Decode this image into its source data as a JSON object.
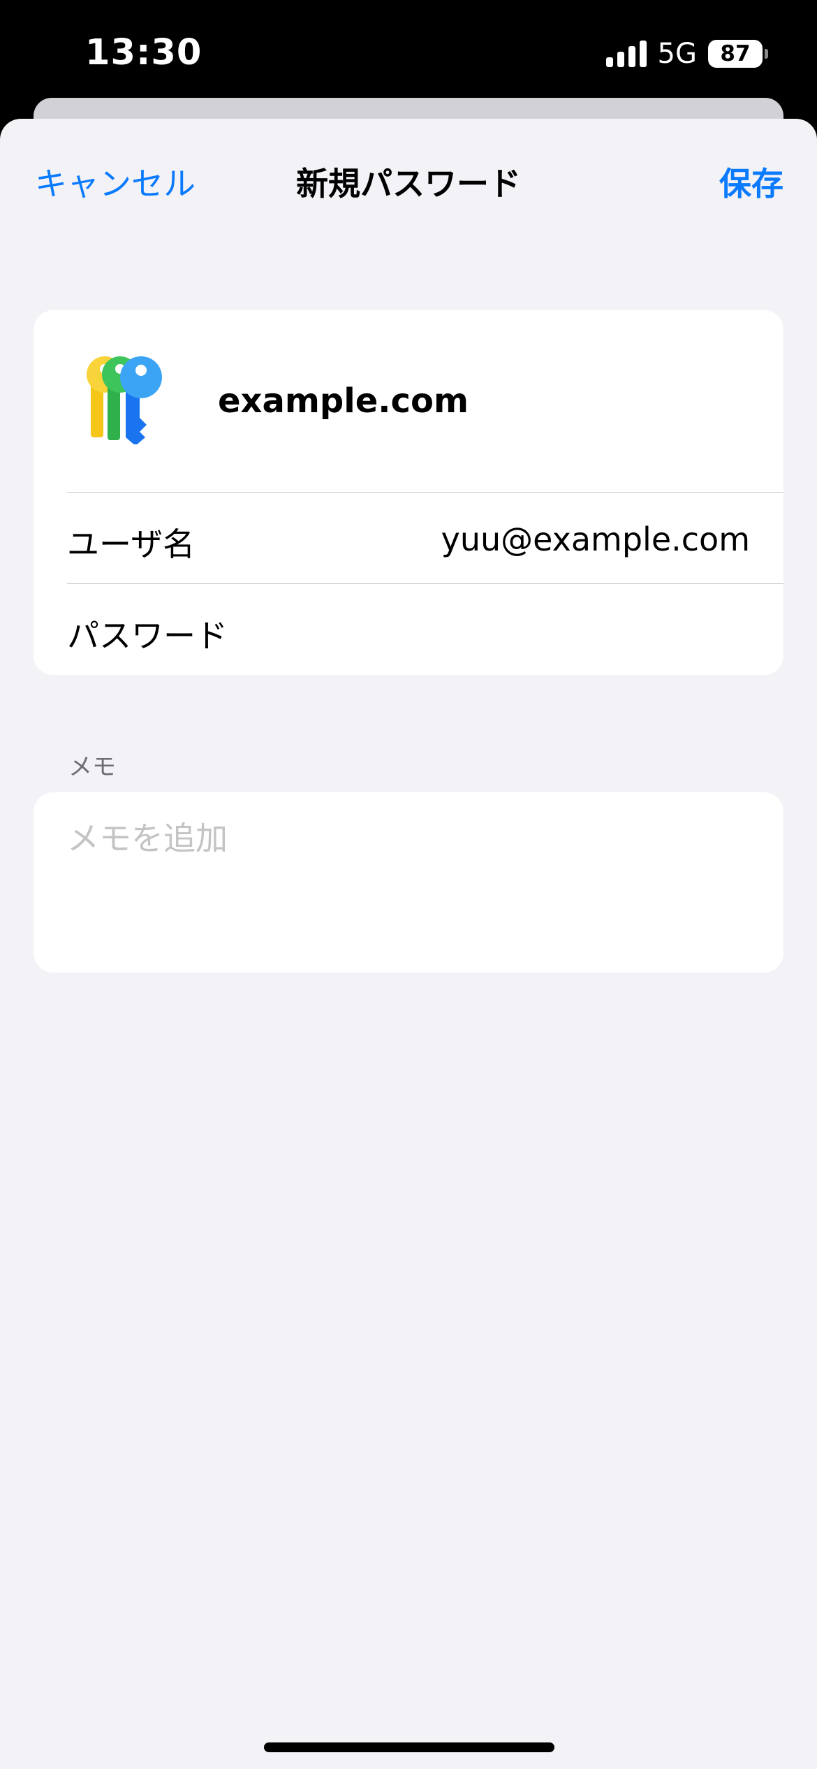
{
  "status_bar": {
    "time": "13:30",
    "network": "5G",
    "battery": "87"
  },
  "nav": {
    "cancel_label": "キャンセル",
    "title": "新規パスワード",
    "save_label": "保存"
  },
  "credential": {
    "site": "example.com",
    "username_label": "ユーザ名",
    "username_value": "yuu@example.com",
    "password_label": "パスワード",
    "password_value": ""
  },
  "notes": {
    "header": "メモ",
    "placeholder": "メモを追加",
    "value": ""
  },
  "icons": {
    "app": "passwords-keys-icon",
    "signal": "cellular-signal-icon",
    "battery": "battery-icon"
  },
  "colors": {
    "accent": "#0a7aff",
    "background": "#f2f2f7",
    "card": "#ffffff"
  }
}
